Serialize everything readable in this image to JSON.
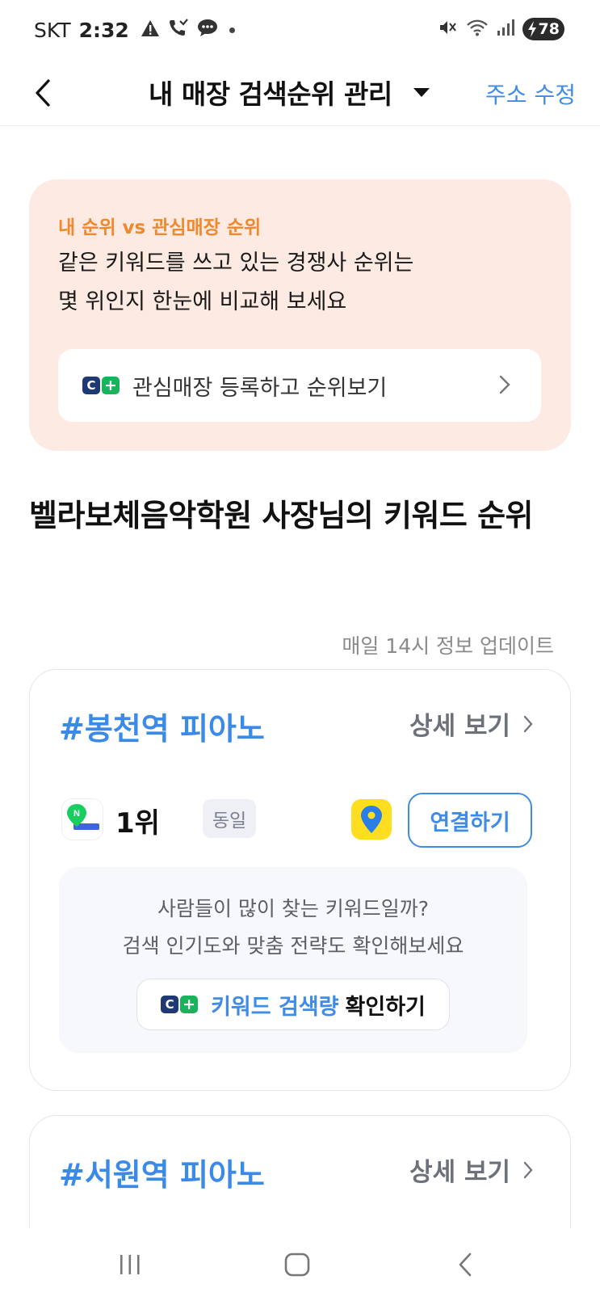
{
  "status_bar": {
    "carrier": "SKT",
    "time": "2:32",
    "battery": "78"
  },
  "header": {
    "title": "내 매장 검색순위 관리",
    "edit_address": "주소 수정"
  },
  "promo": {
    "eyebrow": "내 순위 vs 관심매장 순위",
    "line1": "같은 키워드를 쓰고 있는 경쟁사 순위는",
    "line2": "몇 위인지 한눈에 비교해 보세요",
    "cta_label": "관심매장 등록하고 순위보기"
  },
  "section": {
    "title": "벨라보체음악학원 사장님의 키워드 순위",
    "update_note": "매일 14시 정보 업데이트"
  },
  "keyword_cards": [
    {
      "tag": "#봉천역 피아노",
      "detail_label": "상세 보기",
      "rank": "1위",
      "rank_change": "동일",
      "connect_label": "연결하기",
      "prompt_line1": "사람들이 많이 찾는 키워드일까?",
      "prompt_line2": "검색 인기도와 맞춤 전략도 확인해보세요",
      "volume_label_highlight": "키워드 검색량",
      "volume_label_rest": "확인하기"
    },
    {
      "tag": "#서원역 피아노",
      "detail_label": "상세 보기"
    }
  ],
  "colors": {
    "accent_blue": "#3f8be6",
    "promo_bg": "#fdeae2",
    "promo_eyebrow": "#f0882e",
    "kakao_yellow": "#ffde1f"
  },
  "icons": {
    "back": "back-arrow-icon",
    "title_dropdown": "caret-down-icon",
    "cplus_logo": "cplus-logo-icon",
    "chevron": "chevron-right-icon",
    "naver_map": "naver-map-icon",
    "kakao_map": "kakao-map-icon"
  }
}
